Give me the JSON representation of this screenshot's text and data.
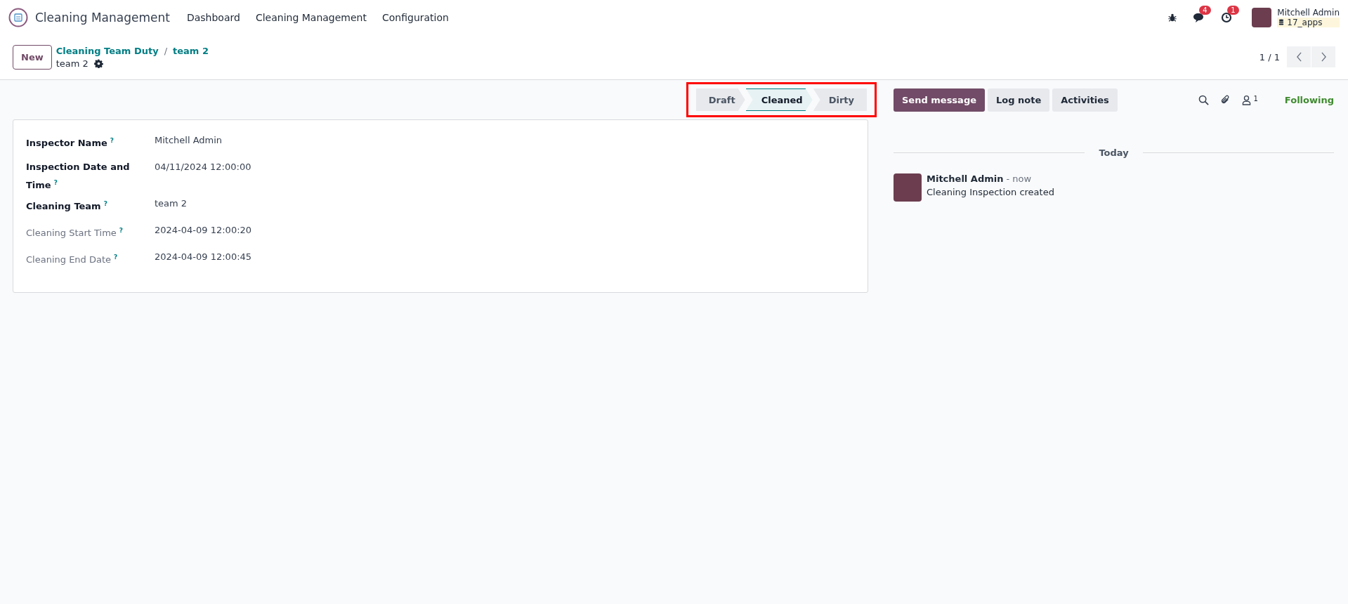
{
  "navbar": {
    "app_name": "Cleaning Management",
    "menu": [
      "Dashboard",
      "Cleaning Management",
      "Configuration"
    ],
    "messages_badge": "4",
    "activities_badge": "1",
    "user": {
      "name": "Mitchell Admin",
      "database": "17_apps"
    }
  },
  "control_panel": {
    "new_button": "New",
    "breadcrumbs": [
      "Cleaning Team Duty",
      "team 2"
    ],
    "breadcrumb_separator": "/",
    "record_name": "team 2",
    "pager": "1 / 1"
  },
  "statusbar": {
    "highlighted": true,
    "stages": [
      {
        "label": "Draft",
        "selected": false
      },
      {
        "label": "Cleaned",
        "selected": true
      },
      {
        "label": "Dirty",
        "selected": false
      }
    ]
  },
  "form": {
    "fields": [
      {
        "label": "Inspector Name",
        "help": "?",
        "required": true,
        "value": "Mitchell Admin"
      },
      {
        "label": "Inspection Date and Time",
        "help": "?",
        "required": true,
        "value": "04/11/2024 12:00:00"
      },
      {
        "label": "Cleaning Team",
        "help": "?",
        "required": true,
        "value": "team 2"
      },
      {
        "label": "Cleaning Start Time",
        "help": "?",
        "required": false,
        "value": "2024-04-09 12:00:20"
      },
      {
        "label": "Cleaning End Date",
        "help": "?",
        "required": false,
        "value": "2024-04-09 12:00:45"
      }
    ]
  },
  "chatter": {
    "buttons": [
      {
        "label": "Send message",
        "selected": true
      },
      {
        "label": "Log note",
        "selected": false
      },
      {
        "label": "Activities",
        "selected": false
      }
    ],
    "followers_count": "1",
    "follow_label": "Following",
    "date_separator": "Today",
    "messages": [
      {
        "author": "Mitchell Admin",
        "time": "- now",
        "body": "Cleaning Inspection created"
      }
    ]
  }
}
